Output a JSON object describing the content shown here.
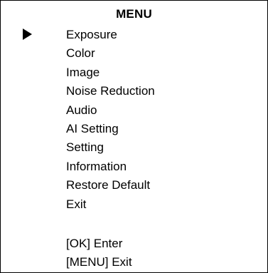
{
  "menu": {
    "title": "MENU",
    "cursor_icon": "right-triangle-icon",
    "selected_index": 0,
    "items": [
      {
        "label": "Exposure"
      },
      {
        "label": "Color"
      },
      {
        "label": "Image"
      },
      {
        "label": "Noise Reduction"
      },
      {
        "label": "Audio"
      },
      {
        "label": "AI Setting"
      },
      {
        "label": "Setting"
      },
      {
        "label": "Information"
      },
      {
        "label": "Restore Default"
      },
      {
        "label": "Exit"
      }
    ]
  },
  "hints": {
    "enter": "[OK] Enter",
    "exit": "[MENU] Exit"
  },
  "colors": {
    "background": "#ffffff",
    "text": "#000000",
    "border": "#000000"
  }
}
